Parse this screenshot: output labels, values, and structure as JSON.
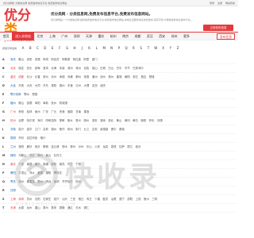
{
  "topbar": {
    "notice": "[优分类网] 分类信息网 免费发布信息平台 免费发布信息网站",
    "links": [
      "登录",
      "注册",
      "网站导航"
    ]
  },
  "logo": {
    "mark_a": "优分",
    "mark_b": "类",
    "domain": "youfenlei.com"
  },
  "intro": {
    "headline": "优分类网 - 分类信息网,免费发布信息平台,免费发布信息网站。",
    "desc": "优分类网是一个分类信息网,提供免费发布信息平台,免费发布信息网站,本地生活服务信息免费发布,真实可靠,方便快捷的信息发布平台。"
  },
  "cta": "立即发布信息",
  "nav": {
    "items": [
      "首页",
      "进入本地站",
      "北京",
      "上海",
      "广州",
      "深圳",
      "天津",
      "重庆",
      "杭州",
      "南京",
      "成都",
      "武汉",
      "西安",
      "苏州",
      "更多"
    ],
    "active_index": 1,
    "post_label": "发布信息"
  },
  "letters": {
    "hint": "按首字母选择",
    "items": [
      "A",
      "B",
      "C",
      "D",
      "E",
      "F",
      "G",
      "H",
      "J",
      "K",
      "L",
      "M",
      "N",
      "P",
      "Q",
      "R",
      "S",
      "T",
      "W",
      "X",
      "Y",
      "Z"
    ]
  },
  "rows": [
    {
      "key": "A",
      "cities": [
        "安庆",
        "鞍山",
        "安阳",
        "安顺",
        "阿坝",
        "阿克苏",
        "阿勒泰",
        "阿拉善",
        "阿里",
        "澳门"
      ]
    },
    {
      "key": "B",
      "cities": [
        "北京",
        "保定",
        "包头",
        "蚌埠",
        "宝鸡",
        "北海",
        "本溪",
        "滨州",
        "亳州",
        "百色",
        "保山",
        "白城",
        "白山",
        "巴中",
        "毕节",
        "巴彦淖尔"
      ]
    },
    {
      "key": "C",
      "cities": [
        "重庆",
        "成都",
        "长沙",
        "长春",
        "常州",
        "沧州",
        "承德",
        "赤峰",
        "郴州",
        "常德",
        "潮州",
        "池州",
        "滁州",
        "巢湖",
        "朝阳",
        "崇左",
        "昌吉",
        "楚雄"
      ]
    },
    {
      "key": "D",
      "cities": [
        "大连",
        "东莞",
        "大庆",
        "大同",
        "丹东",
        "德阳",
        "德州",
        "东营",
        "达州",
        "大理",
        "定西",
        "迪庆"
      ]
    },
    {
      "key": "E",
      "cities": [
        "鄂尔多斯",
        "鄂州",
        "恩施"
      ]
    },
    {
      "key": "F",
      "cities": [
        "福州",
        "佛山",
        "抚顺",
        "阜阳",
        "阜新",
        "抚州",
        "防城港"
      ]
    },
    {
      "key": "G",
      "cities": [
        "广州",
        "贵阳",
        "桂林",
        "赣州",
        "广安",
        "广元",
        "贵港",
        "固原",
        "甘南",
        "果洛"
      ]
    },
    {
      "key": "H",
      "cities": [
        "杭州",
        "合肥",
        "哈尔滨",
        "海口",
        "呼和浩特",
        "邯郸",
        "衡水",
        "惠州",
        "湖州",
        "淮安",
        "淮南",
        "淮北",
        "黄山",
        "黄冈",
        "黄石",
        "衡阳",
        "怀化",
        "河源"
      ]
    },
    {
      "key": "J",
      "cities": [
        "济南",
        "嘉兴",
        "金华",
        "江门",
        "吉林",
        "锦州",
        "焦作",
        "荆州",
        "荆门",
        "九江",
        "吉安",
        "景德镇",
        "晋中",
        "晋城"
      ]
    },
    {
      "key": "K",
      "cities": [
        "昆明",
        "开封",
        "克拉玛依",
        "喀什"
      ]
    },
    {
      "key": "L",
      "cities": [
        "兰州",
        "洛阳",
        "廊坊",
        "临沂",
        "聊城",
        "连云港",
        "丽水",
        "柳州",
        "泸州",
        "乐山",
        "六安",
        "龙岩",
        "娄底",
        "拉萨",
        "丽江",
        "临汾"
      ]
    },
    {
      "key": "M",
      "cities": [
        "绵阳",
        "马鞍山",
        "茂名",
        "梅州",
        "眉山",
        "牡丹江"
      ]
    },
    {
      "key": "N",
      "cities": [
        "南京",
        "宁波",
        "南昌",
        "南宁",
        "南通",
        "南阳",
        "南充",
        "内江",
        "宁德"
      ]
    },
    {
      "key": "P",
      "cities": [
        "莆田",
        "平顶山",
        "萍乡",
        "盘锦",
        "濮阳",
        "攀枝花"
      ]
    },
    {
      "key": "Q",
      "cities": [
        "青岛",
        "泉州",
        "秦皇岛",
        "衢州",
        "清远",
        "曲靖",
        "齐齐哈尔",
        "钦州"
      ]
    },
    {
      "key": "R",
      "cities": [
        "日照"
      ]
    },
    {
      "key": "S",
      "cities": [
        "上海",
        "深圳",
        "苏州",
        "沈阳",
        "石家庄",
        "绍兴",
        "汕头",
        "三亚",
        "宿迁",
        "商丘",
        "十堰",
        "韶关",
        "汕尾",
        "遂宁",
        "邵阳",
        "上饶",
        "宿州",
        "三明"
      ]
    },
    {
      "key": "T",
      "cities": [
        "天津",
        "太原",
        "台州",
        "唐山",
        "泰州",
        "泰安",
        "铜陵",
        "通辽",
        "天水",
        "铜仁"
      ]
    }
  ],
  "watermark": {
    "text": "快收录",
    "sub": "KUAISHOULU.COM"
  },
  "colors": {
    "accent": "#e4393c",
    "logo_secondary": "#f08a00",
    "link_blue": "#1a66b3"
  }
}
